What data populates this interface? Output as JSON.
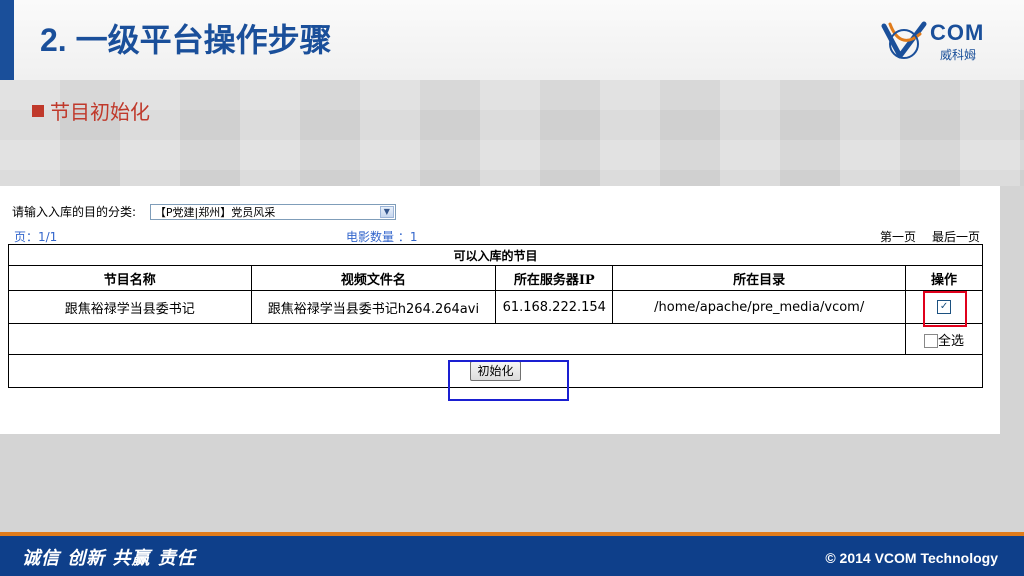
{
  "slide": {
    "title": "2. 一级平台操作步骤",
    "section": "节目初始化",
    "logo": {
      "text": "COM",
      "subtext": "威科姆",
      "mark_icon": "vcom-v-mark-icon"
    },
    "footer": {
      "slogan": "诚信 创新 共赢 责任",
      "copyright": "© 2014 VCOM Technology"
    }
  },
  "panel": {
    "category_label": "请输入入库的目的分类:",
    "category_selected": "【P党建|郑州】党员风采",
    "page_info": "页：1/1",
    "movie_count": "电影数量 ：1",
    "nav": {
      "first": "第一页",
      "last": "最后一页"
    },
    "table": {
      "caption": "可以入库的节目",
      "columns": [
        "节目名称",
        "视频文件名",
        "所在服务器IP",
        "所在目录",
        "操作"
      ],
      "rows": [
        {
          "name": "跟焦裕禄学当县委书记",
          "file": "跟焦裕禄学当县委书记h264.264avi",
          "ip": "61.168.222.154",
          "dir": "/home/apache/pre_media/vcom/",
          "checked": true
        }
      ],
      "select_all_label": "全选",
      "init_button": "初始化"
    }
  },
  "colors": {
    "title_blue": "#1a4f9a",
    "section_red": "#c0392b",
    "footer_blue": "#0e3f8a",
    "highlight_red": "#e0001b",
    "highlight_blue": "#1a1fd1"
  }
}
